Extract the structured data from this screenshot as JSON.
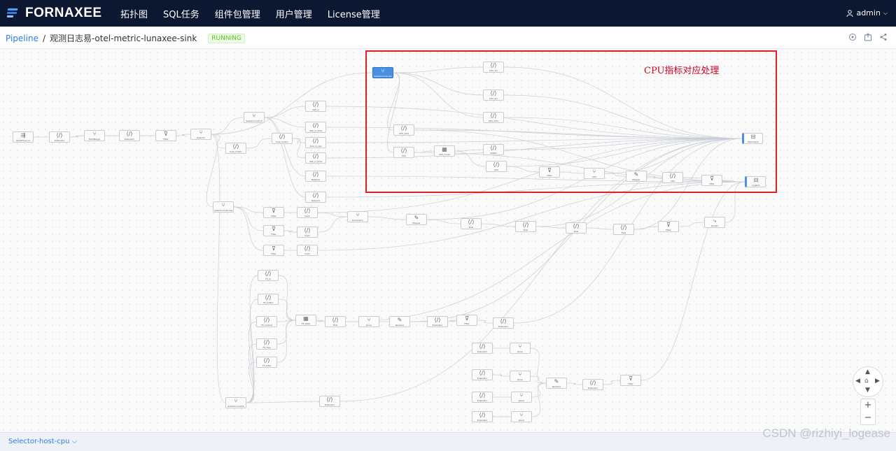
{
  "app": {
    "brand": "FORNAXEE",
    "user": "admin"
  },
  "nav": [
    "拓扑图",
    "SQL任务",
    "组件包管理",
    "用户管理",
    "License管理"
  ],
  "breadcrumb": {
    "root": "Pipeline",
    "separator": "/",
    "current": "观测日志易-otel-metric-lunaxee-sink",
    "status": "RUNNING"
  },
  "annotation": {
    "text": "CPU指标对应处理"
  },
  "bottom": {
    "selected_node": "Selector-host-cpu"
  },
  "watermark": "CSDN @rizhiyi_logease",
  "colors": {
    "topbar": "#0c1732",
    "accent": "#2f7de1",
    "annotation": "#e32020",
    "running": "#52c41a"
  },
  "nodes": [
    {
      "id": "n1",
      "label": "OpAbFSource",
      "icon": "ingest"
    },
    {
      "id": "n2",
      "label": "Evaluator",
      "icon": "code"
    },
    {
      "id": "n3",
      "label": "FieldMerge",
      "icon": "split"
    },
    {
      "id": "n4",
      "label": "Evaluator",
      "icon": "code"
    },
    {
      "id": "n5",
      "label": "Filter",
      "icon": "filter"
    },
    {
      "id": "n6",
      "label": "Selector",
      "icon": "split"
    },
    {
      "id": "n7",
      "label": "Selector-host-m",
      "icon": "split"
    },
    {
      "id": "n8",
      "label": "host_metric",
      "icon": "code"
    },
    {
      "id": "n9",
      "label": "host_metric",
      "icon": "code"
    },
    {
      "id": "n10",
      "label": "disk_io",
      "icon": "code"
    },
    {
      "id": "n11",
      "label": "disk_io_time",
      "icon": "code"
    },
    {
      "id": "n12",
      "label": "disk_io_ops",
      "icon": "code"
    },
    {
      "id": "n13",
      "label": "disk_io_time",
      "icon": "code"
    },
    {
      "id": "n14",
      "label": "Network",
      "icon": "code"
    },
    {
      "id": "n15",
      "label": "Network",
      "icon": "code"
    },
    {
      "id": "n16",
      "label": "Selector-host-cpu",
      "icon": "split"
    },
    {
      "id": "n17",
      "label": "CPU_1m",
      "icon": "code"
    },
    {
      "id": "n18",
      "label": "CPU_5m",
      "icon": "code"
    },
    {
      "id": "n19",
      "label": "CPU_15m",
      "icon": "code"
    },
    {
      "id": "n20",
      "label": "CPU_load",
      "icon": "code"
    },
    {
      "id": "n21",
      "label": "CPU",
      "icon": "code"
    },
    {
      "id": "n22",
      "label": "CPU_mode",
      "icon": "chart"
    },
    {
      "id": "n23",
      "label": "NUMA",
      "icon": "code"
    },
    {
      "id": "n24",
      "label": "CPU",
      "icon": "code"
    },
    {
      "id": "n25",
      "label": "Filter",
      "icon": "filter"
    },
    {
      "id": "n26",
      "label": "CPU",
      "icon": "split"
    },
    {
      "id": "n27",
      "label": "Mapper",
      "icon": "edit"
    },
    {
      "id": "n28",
      "label": "CPU",
      "icon": "code"
    },
    {
      "id": "n29",
      "label": "Filter",
      "icon": "filter"
    },
    {
      "id": "n30",
      "label": "MetricSink",
      "icon": "sink"
    },
    {
      "id": "n31",
      "label": "LogSink",
      "icon": "sink"
    },
    {
      "id": "n32",
      "label": "Selector-host-mem",
      "icon": "split"
    },
    {
      "id": "n33",
      "label": "Filter",
      "icon": "filter"
    },
    {
      "id": "n34",
      "label": "Filter",
      "icon": "filter"
    },
    {
      "id": "n35",
      "label": "Filter",
      "icon": "filter"
    },
    {
      "id": "n36",
      "label": "mem",
      "icon": "code"
    },
    {
      "id": "n37",
      "label": "mem",
      "icon": "code"
    },
    {
      "id": "n38",
      "label": "mem",
      "icon": "code"
    },
    {
      "id": "n39",
      "label": "Dimension",
      "icon": "split"
    },
    {
      "id": "n40",
      "label": "Mapper",
      "icon": "edit"
    },
    {
      "id": "n41",
      "label": "Eval",
      "icon": "code"
    },
    {
      "id": "n42",
      "label": "Eval",
      "icon": "code"
    },
    {
      "id": "n43",
      "label": "Eval",
      "icon": "code"
    },
    {
      "id": "n44",
      "label": "Eval",
      "icon": "code"
    },
    {
      "id": "n45",
      "label": "Filter",
      "icon": "filter"
    },
    {
      "id": "n46",
      "label": "Router",
      "icon": "route"
    },
    {
      "id": "n47",
      "label": "FS_fs",
      "icon": "code"
    },
    {
      "id": "n48",
      "label": "FS_buffer",
      "icon": "code"
    },
    {
      "id": "n49",
      "label": "FS_cached",
      "icon": "code"
    },
    {
      "id": "n50",
      "label": "FS_free",
      "icon": "code"
    },
    {
      "id": "n51",
      "label": "FS_total",
      "icon": "code"
    },
    {
      "id": "n52",
      "label": "FS_stats",
      "icon": "chart"
    },
    {
      "id": "n53",
      "label": "Eval",
      "icon": "code"
    },
    {
      "id": "n54",
      "label": "Joiner",
      "icon": "split"
    },
    {
      "id": "n55",
      "label": "Rename",
      "icon": "edit"
    },
    {
      "id": "n56",
      "label": "Evaluator",
      "icon": "code"
    },
    {
      "id": "n57",
      "label": "Filter",
      "icon": "filter"
    },
    {
      "id": "n58",
      "label": "Evaluator",
      "icon": "code"
    },
    {
      "id": "n59",
      "label": "Selector-host-fs",
      "icon": "split"
    },
    {
      "id": "n60",
      "label": "Evaluator",
      "icon": "code"
    },
    {
      "id": "n61",
      "label": "Evaluator",
      "icon": "code"
    },
    {
      "id": "n62",
      "label": "Evaluator",
      "icon": "code"
    },
    {
      "id": "n63",
      "label": "Evaluator",
      "icon": "code"
    },
    {
      "id": "n64",
      "label": "Evaluator",
      "icon": "code"
    },
    {
      "id": "n65",
      "label": "Joiner",
      "icon": "split"
    },
    {
      "id": "n66",
      "label": "Joiner",
      "icon": "split"
    },
    {
      "id": "n67",
      "label": "Joiner",
      "icon": "split"
    },
    {
      "id": "n68",
      "label": "Joiner",
      "icon": "split"
    },
    {
      "id": "n69",
      "label": "Rename",
      "icon": "edit"
    },
    {
      "id": "n70",
      "label": "Evaluator",
      "icon": "code"
    },
    {
      "id": "n71",
      "label": "Filter",
      "icon": "filter"
    }
  ]
}
